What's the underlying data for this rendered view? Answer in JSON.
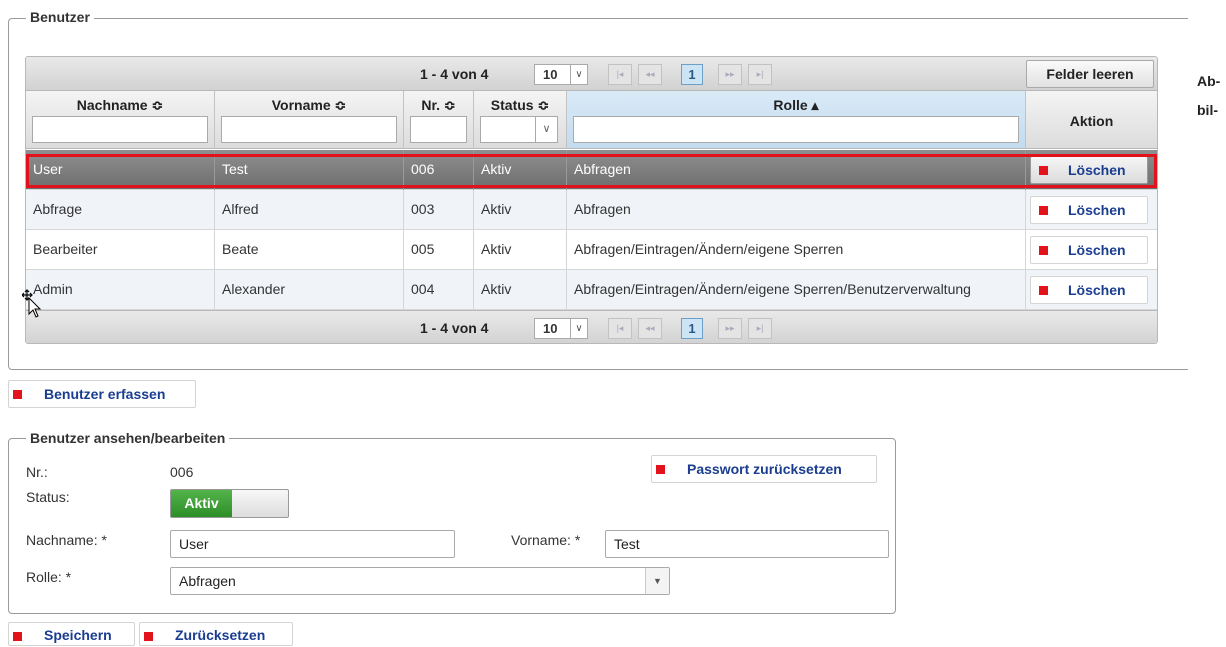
{
  "users_panel": {
    "legend": "Benutzer",
    "pager_top": {
      "count": "1 - 4 von 4",
      "rows_per_page": "10",
      "first": "|◂",
      "prev": "◂◂",
      "current_page": "1",
      "next": "▸▸",
      "last": "▸|"
    },
    "pager_bottom": {
      "count": "1 - 4 von 4",
      "rows_per_page": "10",
      "first": "|◂",
      "prev": "◂◂",
      "current_page": "1",
      "next": "▸▸",
      "last": "▸|"
    },
    "clear_filters_label": "Felder leeren",
    "columns": [
      {
        "label": "Nachname ≎"
      },
      {
        "label": "Vorname ≎"
      },
      {
        "label": "Nr. ≎"
      },
      {
        "label": "Status ≎"
      },
      {
        "label": "Rolle ▴"
      },
      {
        "label": "Aktion"
      }
    ],
    "rows": [
      {
        "nachname": "User",
        "vorname": "Test",
        "nr": "006",
        "status": "Aktiv",
        "rolle": "Abfragen",
        "action": "Löschen"
      },
      {
        "nachname": "Abfrage",
        "vorname": "Alfred",
        "nr": "003",
        "status": "Aktiv",
        "rolle": "Abfragen",
        "action": "Löschen"
      },
      {
        "nachname": "Bearbeiter",
        "vorname": "Beate",
        "nr": "005",
        "status": "Aktiv",
        "rolle": "Abfragen/Eintragen/Ändern/eigene Sperren",
        "action": "Löschen"
      },
      {
        "nachname": "Admin",
        "vorname": "Alexander",
        "nr": "004",
        "status": "Aktiv",
        "rolle": "Abfragen/Eintragen/Ändern/eigene Sperren/Benutzerverwaltung",
        "action": "Löschen"
      }
    ]
  },
  "create_user_button": "Benutzer erfassen",
  "detail_panel": {
    "legend": "Benutzer ansehen/bearbeiten",
    "nr_label": "Nr.:",
    "nr_value": "006",
    "status_label": "Status:",
    "status_value": "Aktiv",
    "reset_password_button": "Passwort zurücksetzen",
    "nachname_label": "Nachname: *",
    "nachname_value": "User",
    "vorname_label": "Vorname: *",
    "vorname_value": "Test",
    "rolle_label": "Rolle: *",
    "rolle_value": "Abfragen"
  },
  "save_button": "Speichern",
  "reset_button": "Zurücksetzen",
  "side_text": {
    "line1": "Ab-",
    "line2": "bil-"
  },
  "colors": {
    "accent_red": "#e3131d",
    "link_blue": "#1a3d8f",
    "toggle_green": "#2d8d27",
    "selected_row": "#7a7a7a"
  }
}
